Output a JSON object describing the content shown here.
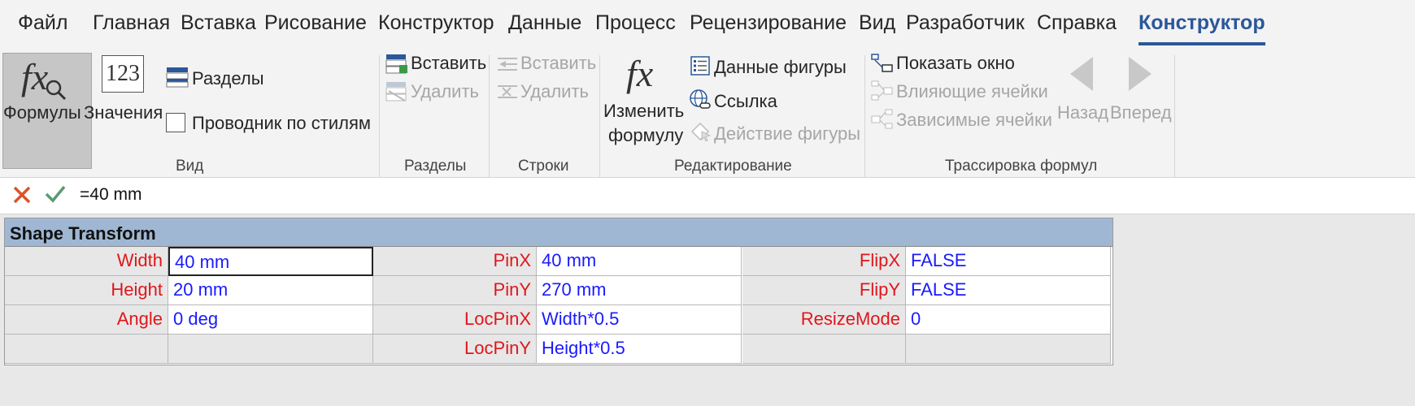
{
  "menu": {
    "tabs": [
      "Файл",
      "Главная",
      "Вставка",
      "Рисование",
      "Конструктор",
      "Данные",
      "Процесс",
      "Рецензирование",
      "Вид",
      "Разработчик",
      "Справка"
    ],
    "active_tab": "Конструктор"
  },
  "ribbon": {
    "view": {
      "formulas": "Формулы",
      "values": "Значения",
      "values_icon_text": "123",
      "sections": "Разделы",
      "style_explorer": "Проводник по стилям",
      "group": "Вид"
    },
    "sections": {
      "insert": "Вставить",
      "delete": "Удалить",
      "group": "Разделы"
    },
    "rows": {
      "insert": "Вставить",
      "delete": "Удалить",
      "group": "Строки"
    },
    "editing": {
      "edit_formula_1": "Изменить",
      "edit_formula_2": "формулу",
      "shape_data": "Данные фигуры",
      "link": "Ссылка",
      "shape_action": "Действие фигуры",
      "group": "Редактирование"
    },
    "trace": {
      "show_window": "Показать окно",
      "precedents": "Влияющие ячейки",
      "dependents": "Зависимые ячейки",
      "back": "Назад",
      "forward": "Вперед",
      "group": "Трассировка формул"
    }
  },
  "formula_bar": {
    "value": "=40 mm"
  },
  "sheet": {
    "title": "Shape Transform",
    "rows": [
      [
        [
          "Width",
          "40 mm"
        ],
        [
          "PinX",
          "40 mm"
        ],
        [
          "FlipX",
          "FALSE"
        ]
      ],
      [
        [
          "Height",
          "20 mm"
        ],
        [
          "PinY",
          "270 mm"
        ],
        [
          "FlipY",
          "FALSE"
        ]
      ],
      [
        [
          "Angle",
          "0 deg"
        ],
        [
          "LocPinX",
          "Width*0.5"
        ],
        [
          "ResizeMode",
          "0"
        ]
      ],
      [
        [
          "",
          ""
        ],
        [
          "LocPinY",
          "Height*0.5"
        ],
        [
          "",
          ""
        ]
      ]
    ]
  },
  "colors": {
    "accent": "#2b579a",
    "label_red": "#e0161b",
    "value_blue": "#1a1aff",
    "header_bg": "#9fb7d3"
  }
}
